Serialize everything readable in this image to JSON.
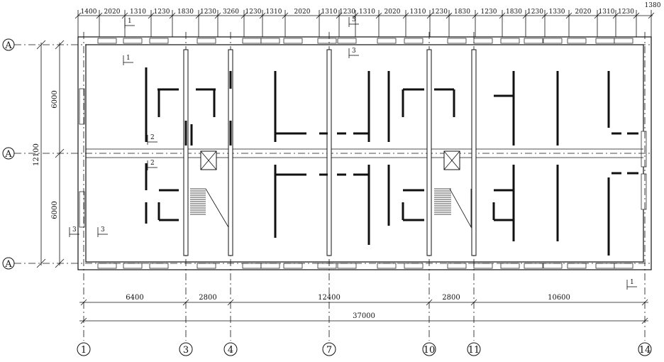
{
  "top_dimensions": [
    "1400",
    "2020",
    "1310",
    "1230",
    "1830",
    "1230",
    "3260",
    "1230",
    "1310",
    "2020",
    "1310",
    "1230",
    "1310",
    "2020",
    "1310",
    "1230",
    "1830",
    "1230",
    "1830",
    "1230",
    "1330",
    "2020",
    "1310",
    "1230",
    "1380"
  ],
  "bottom_dimensions": {
    "segments": [
      "6400",
      "2800",
      "12400",
      "2800",
      "10600"
    ],
    "total": "37000"
  },
  "left_dimensions": {
    "top": "6000",
    "bottom": "6000",
    "total": "12100"
  },
  "row_axes": [
    "A",
    "A",
    "A"
  ],
  "column_axes": [
    "1",
    "3",
    "4",
    "7",
    "10",
    "11",
    "14"
  ],
  "section_marks": [
    "1",
    "1",
    "2",
    "2",
    "3",
    "3",
    "3",
    "3",
    "1"
  ]
}
